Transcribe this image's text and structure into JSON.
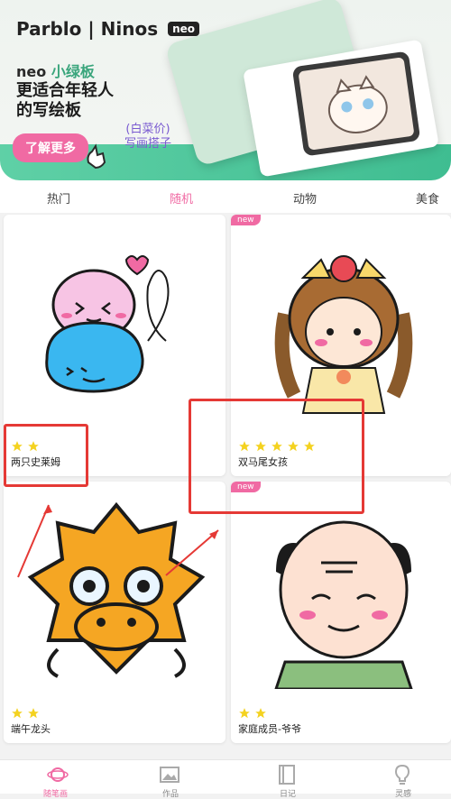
{
  "banner": {
    "brand": "Parblo | Ninos",
    "brand_badge": "neo",
    "neo_prefix": "neo",
    "neo_name": "小绿板",
    "headline_line1": "更适合年轻人",
    "headline_line2": "的写绘板",
    "price_line1": "(白菜价)",
    "price_line2": "写画搭子",
    "cta": "了解更多"
  },
  "tabs": [
    {
      "label": "热门"
    },
    {
      "label": "随机"
    },
    {
      "label": "动物"
    },
    {
      "label": "美食"
    }
  ],
  "active_tab": "随机",
  "cards": [
    {
      "title": "两只史莱姆",
      "stars": 2,
      "new": false
    },
    {
      "title": "双马尾女孩",
      "stars": 5,
      "new": true
    },
    {
      "title": "端午龙头",
      "stars": 2,
      "new": false
    },
    {
      "title": "家庭成员-爷爷",
      "stars": 2,
      "new": true
    }
  ],
  "new_badge": "new",
  "colors": {
    "accent_pink": "#f06aa3",
    "star_yellow": "#f4d21f",
    "annotation_red": "#e53935",
    "banner_green": "#3fbd91"
  },
  "bottom_nav": [
    {
      "icon": "planet-icon",
      "label": "随笔画"
    },
    {
      "icon": "image-icon",
      "label": "作品"
    },
    {
      "icon": "notebook-icon",
      "label": "日记"
    },
    {
      "icon": "lightbulb-icon",
      "label": "灵感"
    }
  ]
}
